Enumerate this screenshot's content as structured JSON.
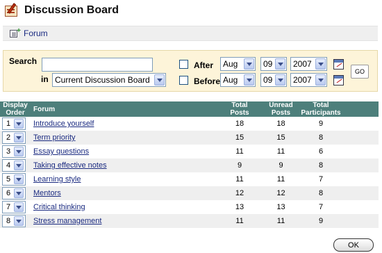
{
  "page": {
    "title": "Discussion Board",
    "title_icon": "discussion-board-icon"
  },
  "breadcrumb": {
    "forum_label": "Forum",
    "forum_icon": "forum-icon"
  },
  "search": {
    "label": "Search",
    "query_value": "",
    "in_label": "in",
    "scope_value": "Current Discussion Board",
    "after": {
      "label": "After",
      "checked": false,
      "month": "Aug",
      "day": "09",
      "year": "2007"
    },
    "before": {
      "label": "Before",
      "checked": false,
      "month": "Aug",
      "day": "09",
      "year": "2007"
    },
    "go_label": "GO"
  },
  "table": {
    "headers": {
      "display_order_1": "Display",
      "display_order_2": "Order",
      "forum": "Forum",
      "total_posts_1": "Total",
      "total_posts_2": "Posts",
      "unread_posts_1": "Unread",
      "unread_posts_2": "Posts",
      "total_participants_1": "Total",
      "total_participants_2": "Participants"
    },
    "rows": [
      {
        "order": "1",
        "forum": "Introduce yourself",
        "total_posts": "18",
        "unread_posts": "18",
        "participants": "9"
      },
      {
        "order": "2",
        "forum": "Term priority",
        "total_posts": "15",
        "unread_posts": "15",
        "participants": "8"
      },
      {
        "order": "3",
        "forum": "Essay questions",
        "total_posts": "11",
        "unread_posts": "11",
        "participants": "6"
      },
      {
        "order": "4",
        "forum": "Taking effective notes",
        "total_posts": "9",
        "unread_posts": "9",
        "participants": "8"
      },
      {
        "order": "5",
        "forum": "Learning style",
        "total_posts": "11",
        "unread_posts": "11",
        "participants": "7"
      },
      {
        "order": "6",
        "forum": "Mentors",
        "total_posts": "12",
        "unread_posts": "12",
        "participants": "8"
      },
      {
        "order": "7",
        "forum": "Critical thinking",
        "total_posts": "13",
        "unread_posts": "13",
        "participants": "7"
      },
      {
        "order": "8",
        "forum": "Stress management",
        "total_posts": "11",
        "unread_posts": "11",
        "participants": "9"
      }
    ]
  },
  "footer": {
    "ok_label": "OK"
  },
  "colors": {
    "header_bg": "#4d7f7b",
    "search_panel_bg": "#fdf4d9",
    "link": "#1a2a80",
    "alt_row": "#efefef"
  }
}
